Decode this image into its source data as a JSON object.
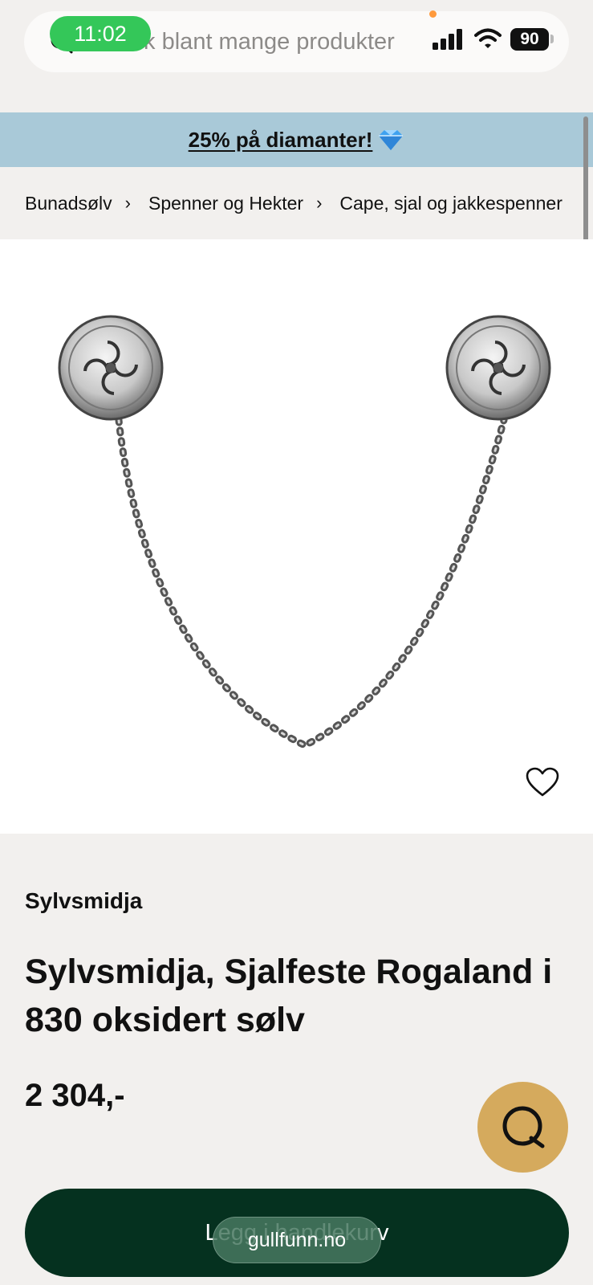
{
  "status_bar": {
    "time": "11:02",
    "battery": "90"
  },
  "search": {
    "placeholder": "Søk blant mange produkter"
  },
  "promo": {
    "text": "25% på diamanter!",
    "icon": "diamond-icon"
  },
  "breadcrumb": {
    "items": [
      "Bunadsølv",
      "Spenner og Hekter",
      "Cape, sjal og jakkespenner"
    ]
  },
  "product": {
    "brand": "Sylvsmidja",
    "title": "Sylvsmidja, Sjalfeste Rogaland i 830 oksidert sølv",
    "price": "2 304,-",
    "image_alt": "Sjalfeste med to runde spenner og kjede"
  },
  "actions": {
    "add_to_cart": "Legg i handlekurv",
    "favorite_icon": "heart-icon",
    "chat_icon": "chat-icon"
  },
  "browser": {
    "url": "gullfunn.no"
  },
  "colors": {
    "background": "#f2f0ee",
    "promo_banner": "#a9c9d8",
    "cart_button": "#05311f",
    "chat_button": "#d5aa5d",
    "time_pill": "#34c759"
  }
}
